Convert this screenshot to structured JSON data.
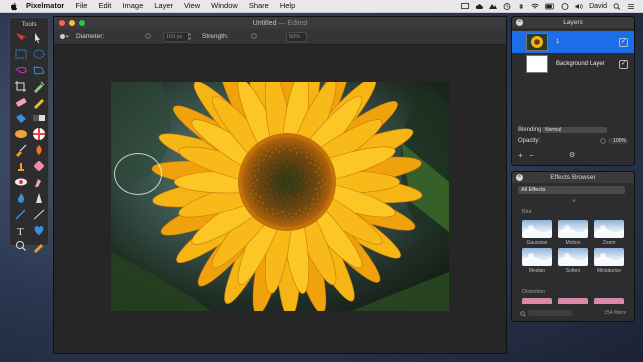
{
  "menubar": {
    "app_name": "Pixelmator",
    "items": [
      "File",
      "Edit",
      "Image",
      "Layer",
      "View",
      "Window",
      "Share",
      "Help"
    ],
    "user": "David"
  },
  "tools": {
    "title": "Tools",
    "items": [
      "move-tool",
      "selection-arrow-tool",
      "rect-select-tool",
      "ellipse-select-tool",
      "lasso-tool",
      "polygon-lasso-tool",
      "crop-tool",
      "eyedropper-tool",
      "eraser-tool",
      "pencil-tool",
      "paint-bucket-tool",
      "gradient-tool",
      "blur-tool",
      "color-wheel-tool",
      "paint-brush-tool",
      "burn-tool",
      "clone-stamp-tool",
      "heal-tool",
      "red-eye-tool",
      "smudge-tool",
      "sponge-tool",
      "sharpen-tool",
      "pen-tool",
      "line-tool",
      "type-tool",
      "shape-tool",
      "zoom-tool",
      "eyedropper-small-tool"
    ]
  },
  "document": {
    "title": "Untitled",
    "edited": "— Edited",
    "diameter_label": "Diameter:",
    "diameter_value": "103 px",
    "strength_label": "Strength:",
    "strength_value": "50%"
  },
  "layers_panel": {
    "title": "Layers",
    "layers": [
      {
        "name": "1",
        "checked": "✓"
      },
      {
        "name": "Background Layer",
        "checked": "✓"
      }
    ],
    "blending_label": "Blending:",
    "blending_value": "Normal",
    "opacity_label": "Opacity:",
    "opacity_value": "100%",
    "add": "+",
    "remove": "−",
    "gear": "⚙"
  },
  "effects_panel": {
    "title": "Effects Browser",
    "category": "All Effects",
    "group_blur": "Blur",
    "group_distortion": "Distortion",
    "effects": [
      "Gaussian",
      "Motion",
      "Zoom",
      "Median",
      "Soften",
      "Miniaturize"
    ],
    "count": "154 filters"
  },
  "colors": {
    "selection_blue": "#1c6ee8",
    "panel_bg": "#2d2d2f",
    "sunflower_petal": "#f7b311",
    "sunflower_center": "#5a4016"
  }
}
